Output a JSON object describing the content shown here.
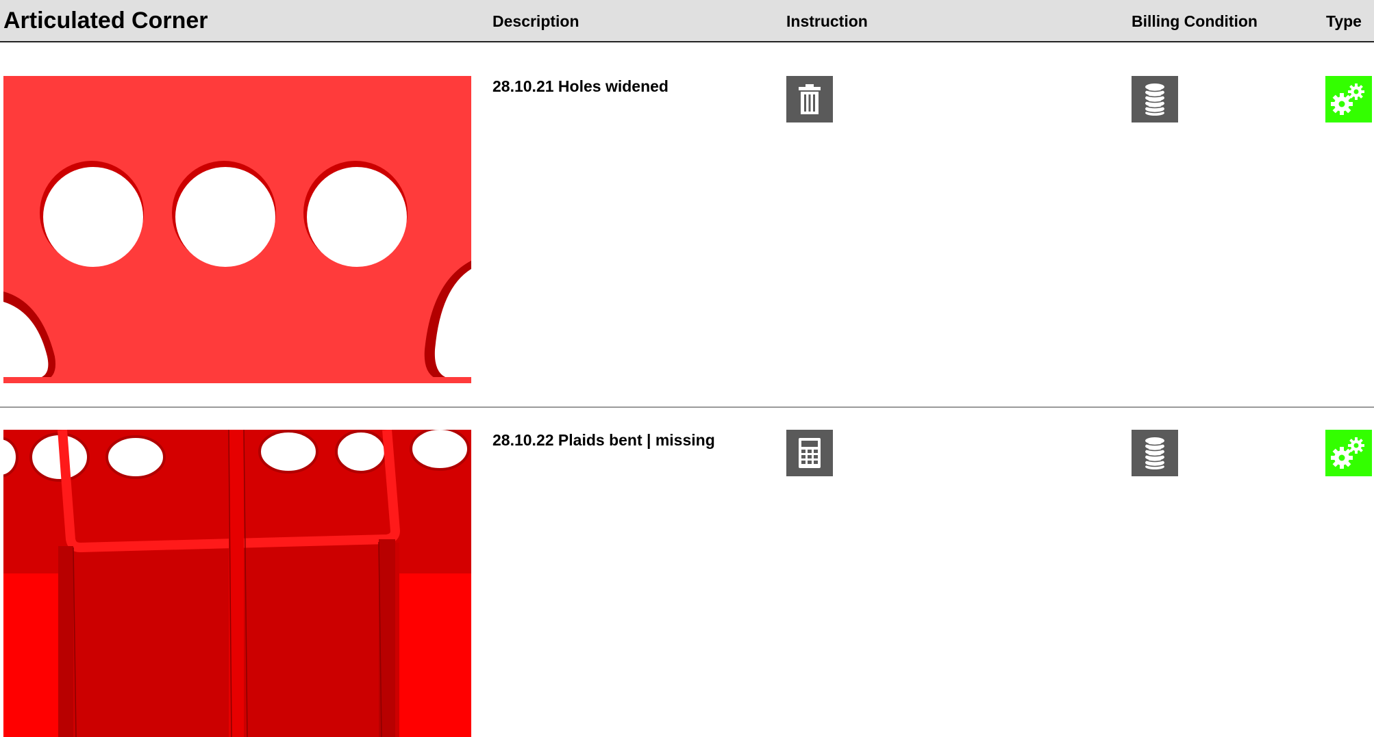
{
  "header": {
    "title": "Articulated Corner",
    "columns": {
      "description": "Description",
      "instruction": "Instruction",
      "billing_condition": "Billing Condition",
      "type": "Type"
    }
  },
  "rows": [
    {
      "image": "red-plate-with-holes-photo",
      "description": "28.10.21 Holes widened",
      "instruction_icon": "trash-icon",
      "billing_icon": "coin-stack-icon",
      "type_icon": "gears-icon"
    },
    {
      "image": "red-bent-plaids-photo",
      "description": "28.10.22 Plaids bent | missing",
      "instruction_icon": "calculator-icon",
      "billing_icon": "coin-stack-icon",
      "type_icon": "gears-icon"
    }
  ],
  "colors": {
    "header_bg": "#e0e0e0",
    "icon_box": "#5a5a5a",
    "type_icon_bg": "#33ff00",
    "part_red": "#ff3a3a"
  }
}
